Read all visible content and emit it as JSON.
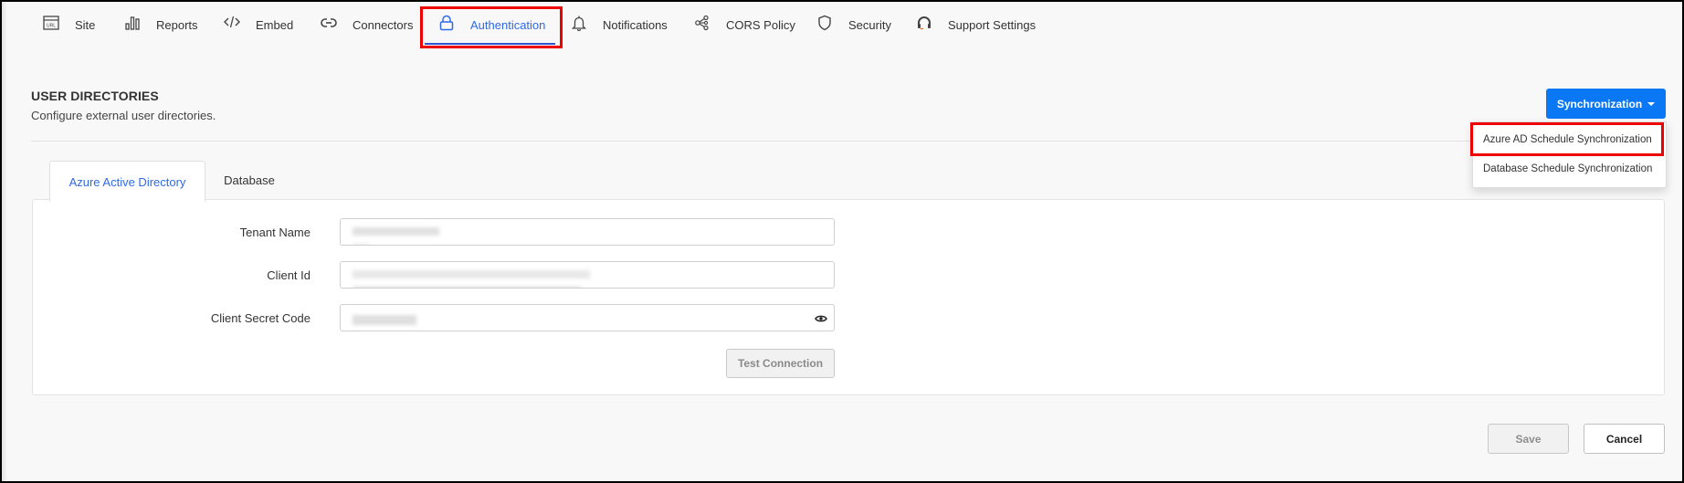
{
  "nav": {
    "items": [
      {
        "label": "Site",
        "icon": "url-icon",
        "active": false
      },
      {
        "label": "Reports",
        "icon": "bar-chart-icon",
        "active": false
      },
      {
        "label": "Embed",
        "icon": "code-icon",
        "active": false
      },
      {
        "label": "Connectors",
        "icon": "link-icon",
        "active": false
      },
      {
        "label": "Authentication",
        "icon": "lock-icon",
        "active": true
      },
      {
        "label": "Notifications",
        "icon": "bell-icon",
        "active": false
      },
      {
        "label": "CORS Policy",
        "icon": "share-nodes-icon",
        "active": false
      },
      {
        "label": "Security",
        "icon": "shield-icon",
        "active": false
      },
      {
        "label": "Support Settings",
        "icon": "headset-icon",
        "active": false
      }
    ]
  },
  "header": {
    "title": "USER DIRECTORIES",
    "subtitle": "Configure external user directories."
  },
  "sync": {
    "button_label": "Synchronization",
    "menu": [
      {
        "label": "Azure AD Schedule Synchronization",
        "highlighted": true
      },
      {
        "label": "Database Schedule Synchronization",
        "highlighted": false
      }
    ]
  },
  "tabs": [
    {
      "label": "Azure Active Directory",
      "active": true
    },
    {
      "label": "Database",
      "active": false
    }
  ],
  "form": {
    "fields": [
      {
        "label": "Tenant Name",
        "value": "[redacted]",
        "masked": false
      },
      {
        "label": "Client Id",
        "value": "[redacted]",
        "masked": false
      },
      {
        "label": "Client Secret Code",
        "value": "[redacted]",
        "masked": true,
        "reveal_icon": "eye-icon"
      }
    ],
    "test_connection_label": "Test Connection"
  },
  "footer": {
    "save_label": "Save",
    "cancel_label": "Cancel"
  },
  "colors": {
    "accent": "#2f6ae6",
    "primary_button": "#0a78f5",
    "highlight_box": "#ee0000"
  }
}
